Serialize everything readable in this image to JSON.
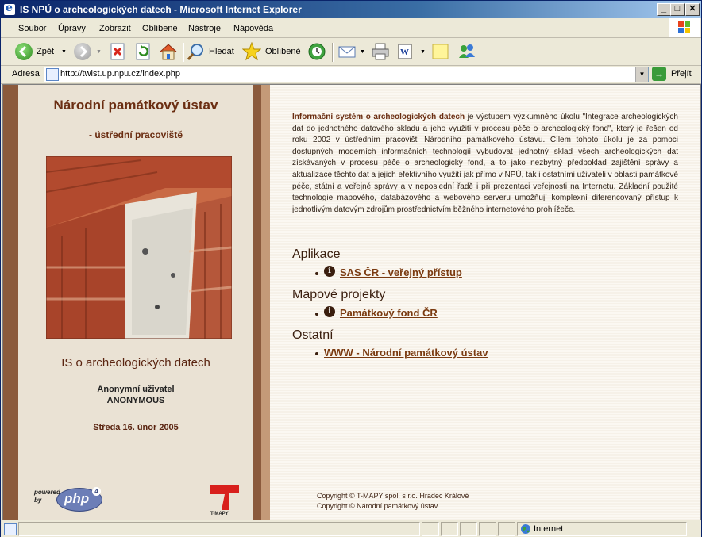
{
  "window": {
    "title": "IS NPÚ o archeologických datech - Microsoft Internet Explorer",
    "minimize": "_",
    "maximize": "□",
    "close": "✕"
  },
  "menu": [
    "Soubor",
    "Úpravy",
    "Zobrazit",
    "Oblíbené",
    "Nástroje",
    "Nápověda"
  ],
  "toolbar": {
    "back_label": "Zpět",
    "search_label": "Hledat",
    "favorites_label": "Oblíbené"
  },
  "address": {
    "label": "Adresa",
    "url": "http://twist.up.npu.cz/index.php",
    "go_label": "Přejít"
  },
  "sidebar": {
    "institution": "Národní památkový ústav",
    "department": "- ústřední pracoviště",
    "system_name": "IS o archeologických datech",
    "user_label": "Anonymní uživatel",
    "user_name": "ANONYMOUS",
    "date": "Středa 16. únor 2005",
    "powered_by": "powered by",
    "php_logo": "php",
    "php_version": "4",
    "tmapy_logo": "T-MAPY"
  },
  "main": {
    "intro_bold": "Informační systém o archeologických datech",
    "intro_rest": " je výstupem výzkumného úkolu \"Integrace archeologických dat do jednotného datového skladu a jeho využití v procesu péče o archeologický fond\", který je řešen od roku 2002 v ústředním pracovišti Národního památkového ústavu. Cílem tohoto úkolu je za pomoci dostupných moderních informačních technologií vybudovat jednotný sklad všech archeologických dat získávaných v procesu péče o archeologický fond, a to jako nezbytný předpoklad zajištění správy a aktualizace těchto dat a jejich efektivního využití jak přímo v NPÚ, tak i ostatními uživateli v oblasti památkové péče, státní a veřejné správy a v neposlední řadě i při prezentaci veřejnosti na Internetu. Základní použité technologie mapového, databázového a webového serveru umožňují komplexní diferencovaný přístup k jednotlivým datovým zdrojům prostřednictvím běžného internetového prohlížeče.",
    "sections": [
      {
        "heading": "Aplikace",
        "link": "SAS ČR - veřejný přístup",
        "info": "i"
      },
      {
        "heading": "Mapové projekty",
        "link": "Památkový fond ČR",
        "info": "i"
      },
      {
        "heading": "Ostatní",
        "link": "WWW - Národní památkový ústav",
        "info": ""
      }
    ],
    "copyright_1": "Copyright © T-MAPY spol. s r.o. Hradec Králové",
    "copyright_2": "Copyright © Národní památkový ústav"
  },
  "statusbar": {
    "zone": "Internet"
  }
}
